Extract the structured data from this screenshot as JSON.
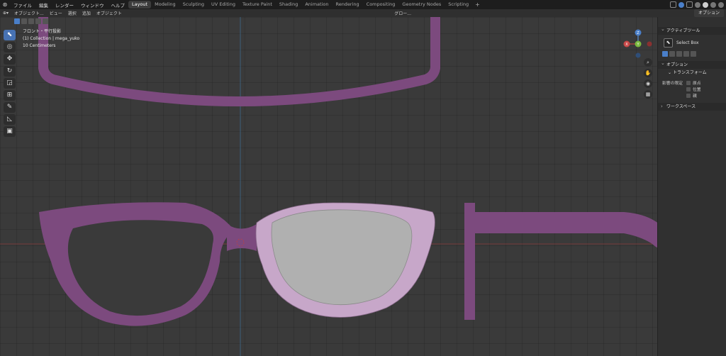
{
  "topbar": {
    "menus": [
      "ファイル",
      "編集",
      "レンダー",
      "ウィンドウ",
      "ヘルプ"
    ],
    "workspaces": [
      "Layout",
      "Modeling",
      "Sculpting",
      "UV Editing",
      "Texture Paint",
      "Shading",
      "Animation",
      "Rendering",
      "Compositing",
      "Geometry Nodes",
      "Scripting"
    ],
    "active_workspace": "Layout",
    "add_tab": "+"
  },
  "header": {
    "mode": "オブジェクト...",
    "menus": [
      "ビュー",
      "選択",
      "追加",
      "オブジェクト"
    ],
    "transform_orientation": "グロー...",
    "options_label": "オプション"
  },
  "overlay": {
    "view_name": "フロント・平行投影",
    "collection": "(1) Collection | mega_yuko",
    "scale": "10 Centimeters"
  },
  "npanel": {
    "active_tool_title": "アクティブツール",
    "select_box": "Select Box",
    "options_title": "オプション",
    "transform_title": "トランスフォーム",
    "affect_only_label": "影響の限定",
    "affect_items": [
      "原点",
      "位置",
      "親"
    ],
    "workspace_title": "ワークスペース"
  },
  "icons": {
    "viewport_axes": [
      "X",
      "Y",
      "Z"
    ],
    "tools": [
      "select-box-icon",
      "cursor-icon",
      "move-icon",
      "rotate-icon",
      "scale-icon",
      "transform-icon",
      "annotate-icon",
      "measure-icon",
      "add-cube-icon"
    ]
  },
  "colors": {
    "frame": "#7c4a7e",
    "frame_selected": "#c7a7c9",
    "lens": "#b0b0b0",
    "viewport_bg": "#3a3a3a",
    "accent": "#4772b3"
  }
}
